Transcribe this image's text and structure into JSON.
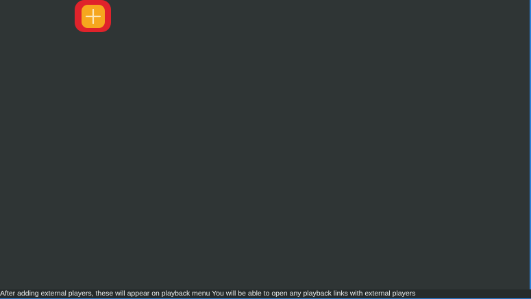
{
  "add_player_button": {
    "icon": "plus-icon",
    "outer_color": "#e0232b",
    "inner_color": "#f6a71e"
  },
  "footer": {
    "message": "After adding external players, these will appear on playback menu You will be able to open any playback links with external players"
  },
  "colors": {
    "background": "#2f3535",
    "accent_border": "#2c7fd6"
  }
}
